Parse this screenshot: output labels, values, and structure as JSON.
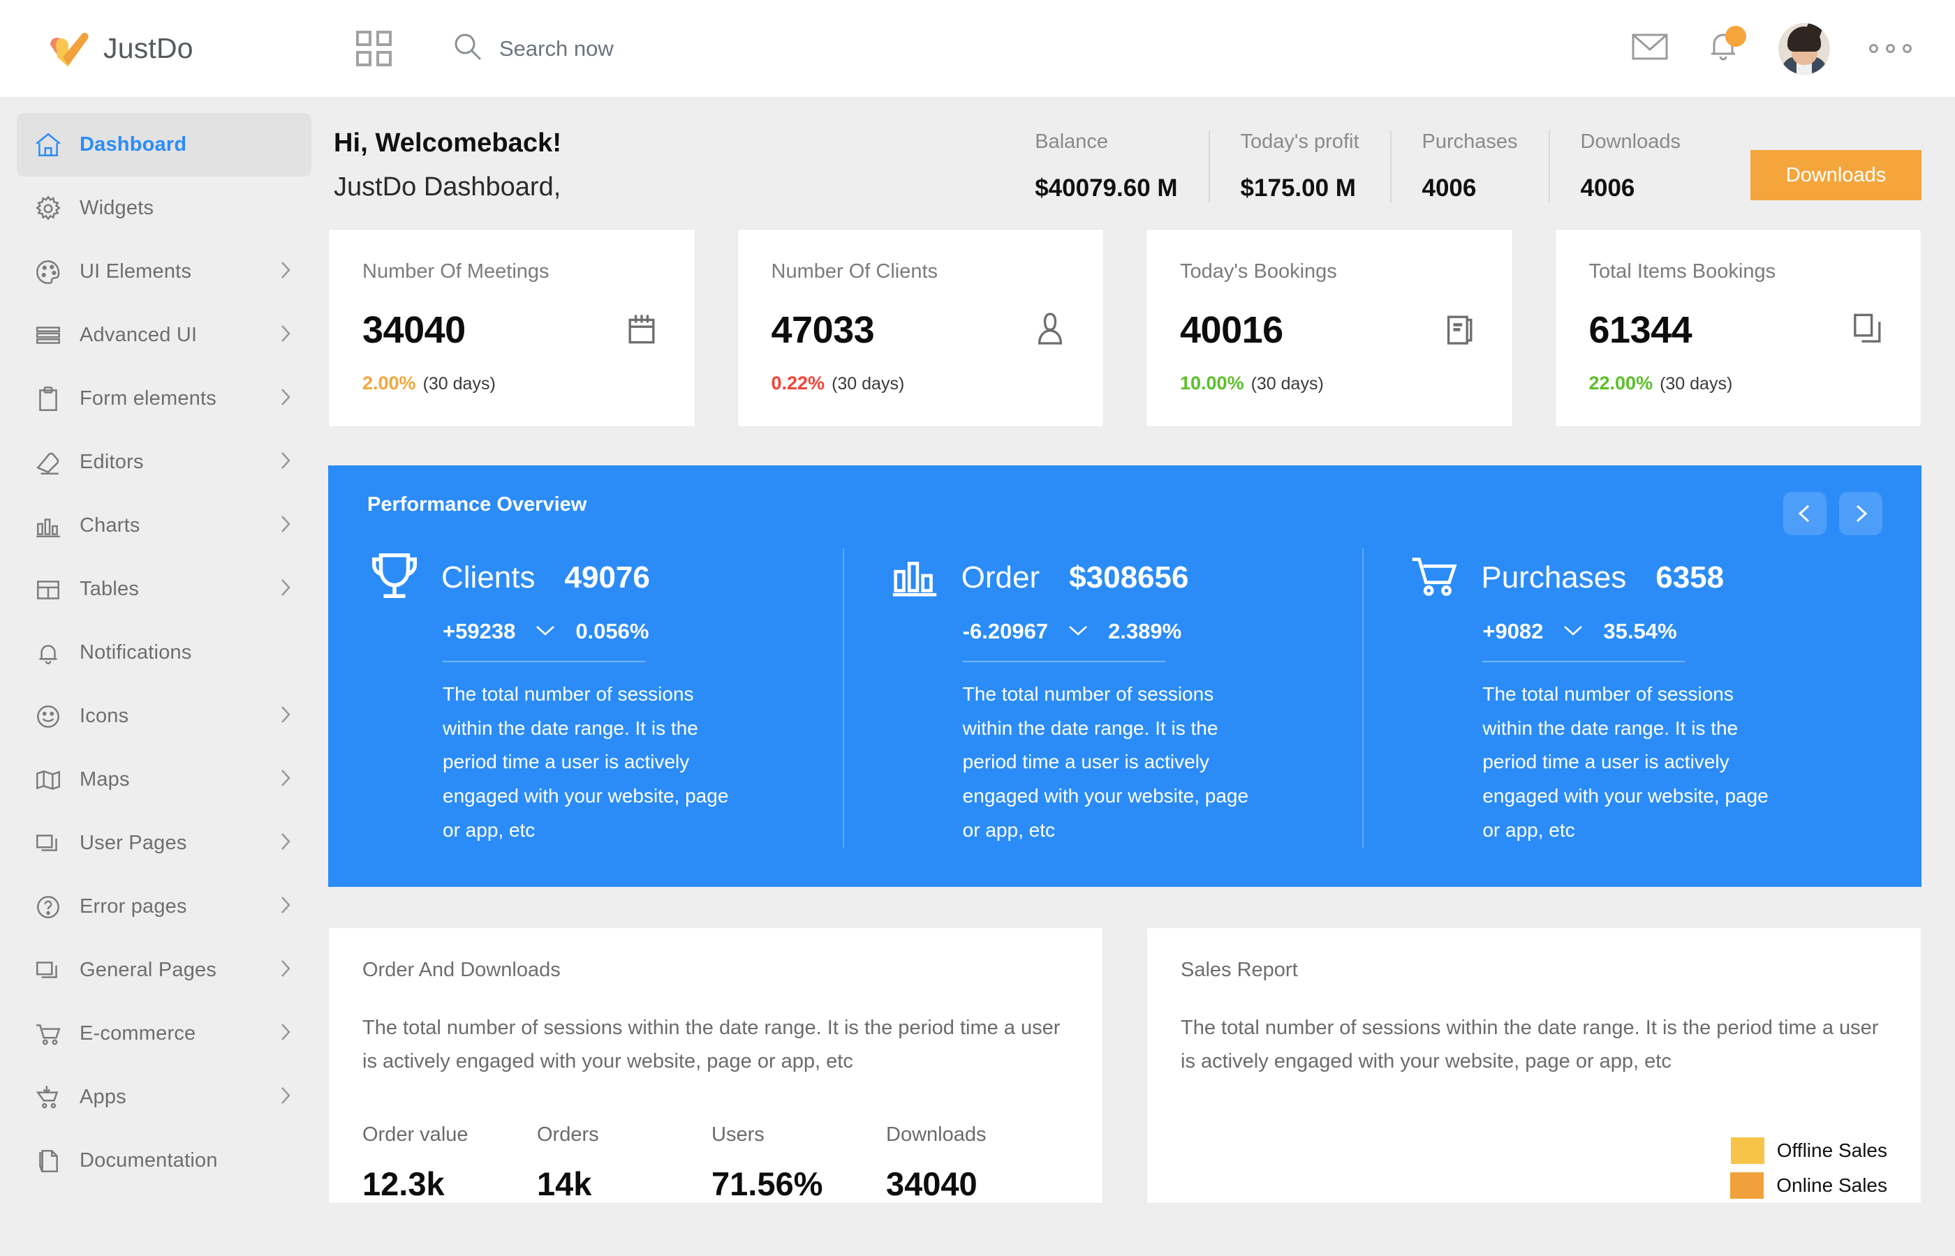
{
  "header": {
    "brand": "JustDo",
    "logo_icon": "check-heart-logo",
    "grid_icon": "apps-grid-icon",
    "search": {
      "placeholder": "Search now",
      "value": "",
      "icon": "search-icon"
    },
    "mail_icon": "envelope-icon",
    "bell_icon": "bell-icon",
    "bell_badge": "",
    "avatar": "user-avatar",
    "more_icon": "more-horizontal-icon",
    "accent_orange": "#f4a63c"
  },
  "sidebar": {
    "items": [
      {
        "label": "Dashboard",
        "icon": "home-icon",
        "active": true,
        "chevron": false
      },
      {
        "label": "Widgets",
        "icon": "gear-icon",
        "active": false,
        "chevron": false
      },
      {
        "label": "UI Elements",
        "icon": "palette-icon",
        "active": false,
        "chevron": true
      },
      {
        "label": "Advanced UI",
        "icon": "layers-list-icon",
        "active": false,
        "chevron": true
      },
      {
        "label": "Form elements",
        "icon": "clipboard-icon",
        "active": false,
        "chevron": true
      },
      {
        "label": "Editors",
        "icon": "eraser-icon",
        "active": false,
        "chevron": true
      },
      {
        "label": "Charts",
        "icon": "bar-chart-icon",
        "active": false,
        "chevron": true
      },
      {
        "label": "Tables",
        "icon": "table-icon",
        "active": false,
        "chevron": true
      },
      {
        "label": "Notifications",
        "icon": "bell-icon",
        "active": false,
        "chevron": false
      },
      {
        "label": "Icons",
        "icon": "smiley-icon",
        "active": false,
        "chevron": true
      },
      {
        "label": "Maps",
        "icon": "map-icon",
        "active": false,
        "chevron": true
      },
      {
        "label": "User Pages",
        "icon": "windows-stack-icon",
        "active": false,
        "chevron": true
      },
      {
        "label": "Error pages",
        "icon": "question-circle-icon",
        "active": false,
        "chevron": true
      },
      {
        "label": "General Pages",
        "icon": "window-copy-icon",
        "active": false,
        "chevron": true
      },
      {
        "label": "E-commerce",
        "icon": "shopping-cart-icon",
        "active": false,
        "chevron": true
      },
      {
        "label": "Apps",
        "icon": "cart-download-icon",
        "active": false,
        "chevron": true
      },
      {
        "label": "Documentation",
        "icon": "document-pen-icon",
        "active": false,
        "chevron": false
      }
    ],
    "active_color": "#2b8cf7"
  },
  "topbar": {
    "greeting": "Hi, Welcomeback!",
    "subtitle": "JustDo Dashboard,",
    "kpis": [
      {
        "label": "Balance",
        "value": "$40079.60 M"
      },
      {
        "label": "Today's profit",
        "value": "$175.00 M"
      },
      {
        "label": "Purchases",
        "value": "4006"
      },
      {
        "label": "Downloads",
        "value": "4006"
      }
    ],
    "download_button": "Downloads"
  },
  "stat_cards": [
    {
      "title": "Number Of Meetings",
      "value": "34040",
      "percent": "2.00%",
      "percent_color": "#f4a63c",
      "period": "(30 days)",
      "icon": "calendar-icon"
    },
    {
      "title": "Number Of Clients",
      "value": "47033",
      "percent": "0.22%",
      "percent_color": "#f44336",
      "period": "(30 days)",
      "icon": "person-icon"
    },
    {
      "title": "Today's Bookings",
      "value": "40016",
      "percent": "10.00%",
      "percent_color": "#5bbf2a",
      "period": "(30 days)",
      "icon": "book-icon"
    },
    {
      "title": "Total Items Bookings",
      "value": "61344",
      "percent": "22.00%",
      "percent_color": "#5bbf2a",
      "period": "(30 days)",
      "icon": "copy-stack-icon"
    }
  ],
  "performance": {
    "title": "Performance Overview",
    "panel_color": "#2b8cf7",
    "prev_icon": "chevron-left-icon",
    "next_icon": "chevron-right-icon",
    "columns": [
      {
        "icon": "trophy-icon",
        "name": "Clients",
        "value": "49076",
        "delta": "+59238",
        "trend_icon": "chevron-down-icon",
        "percent": "0.056%",
        "desc": "The total number of sessions within the date range. It is the period time a user is actively engaged with your website, page or app, etc"
      },
      {
        "icon": "bar-chart-icon",
        "name": "Order",
        "value": "$308656",
        "delta": "-6.20967",
        "trend_icon": "chevron-down-icon",
        "percent": "2.389%",
        "desc": "The total number of sessions within the date range. It is the period time a user is actively engaged with your website, page or app, etc"
      },
      {
        "icon": "shopping-cart-icon",
        "name": "Purchases",
        "value": "6358",
        "delta": "+9082",
        "trend_icon": "chevron-down-icon",
        "percent": "35.54%",
        "desc": "The total number of sessions within the date range. It is the period time a user is actively engaged with your website, page or app, etc"
      }
    ]
  },
  "order_downloads": {
    "title": "Order And Downloads",
    "desc": "The total number of sessions within the date range. It is the period time a user is actively engaged with your website, page or app, etc",
    "metrics": [
      {
        "label": "Order value",
        "value": "12.3k"
      },
      {
        "label": "Orders",
        "value": "14k"
      },
      {
        "label": "Users",
        "value": "71.56%"
      },
      {
        "label": "Downloads",
        "value": "34040"
      }
    ]
  },
  "sales_report": {
    "title": "Sales Report",
    "desc": "The total number of sessions within the date range. It is the period time a user is actively engaged with your website, page or app, etc",
    "legend": [
      {
        "label": "Offline Sales",
        "color": "#f7c348"
      },
      {
        "label": "Online Sales",
        "color": "#f0a13c"
      }
    ]
  }
}
